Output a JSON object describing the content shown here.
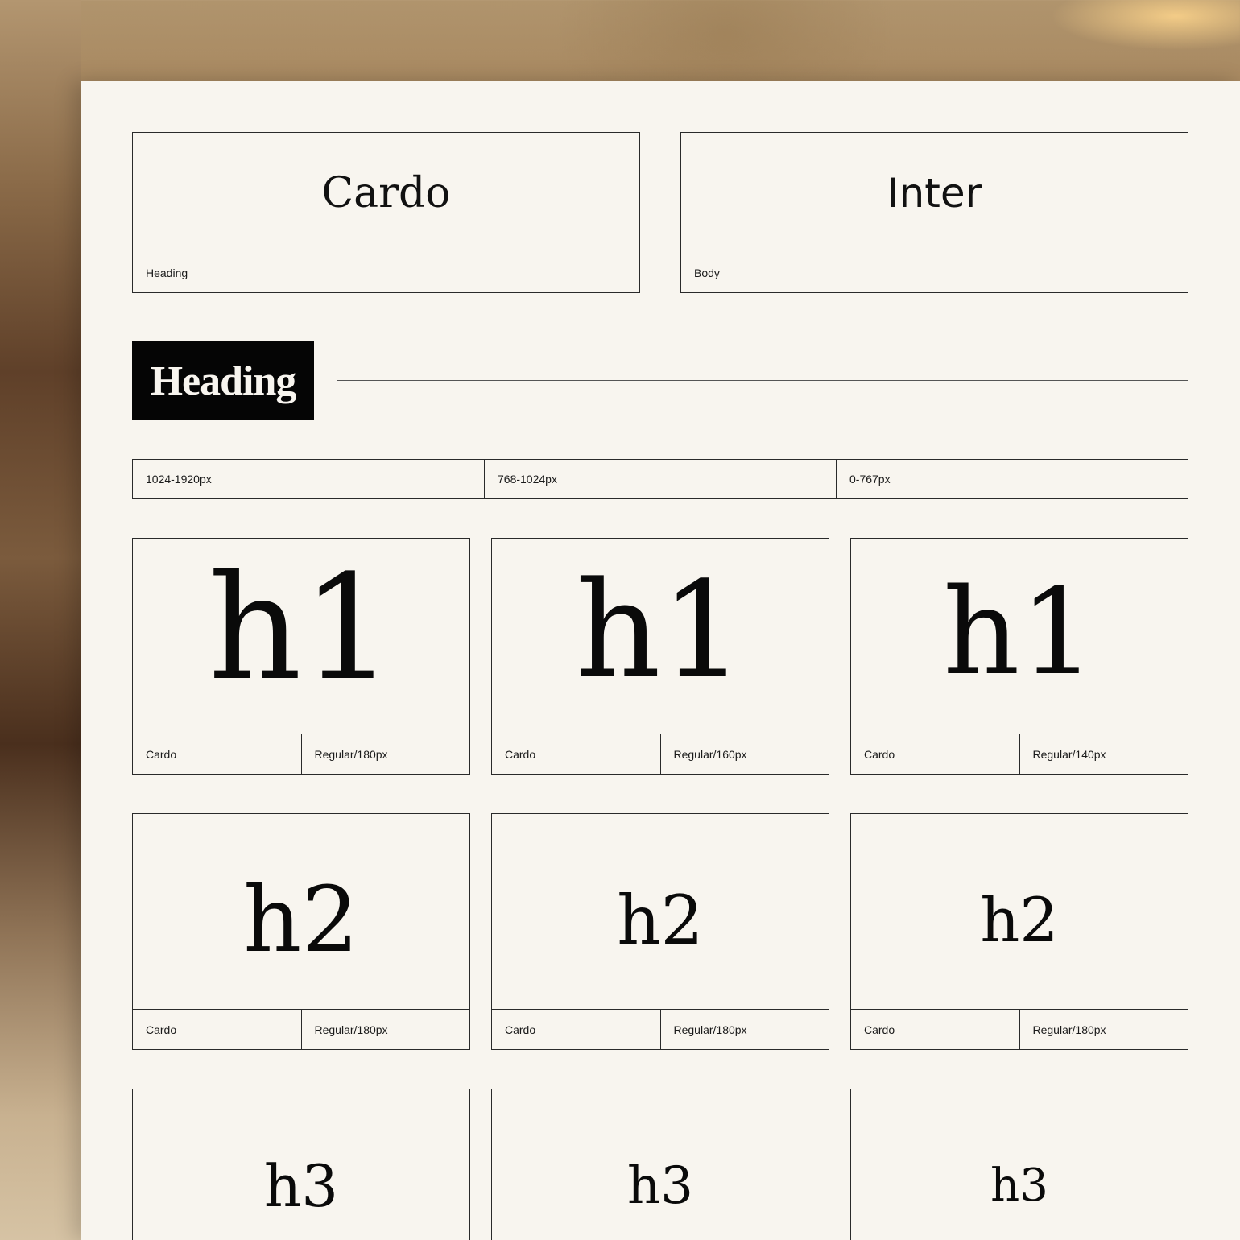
{
  "font_pairing": {
    "heading_font": {
      "name": "Cardo",
      "role": "Heading"
    },
    "body_font": {
      "name": "Inter",
      "role": "Body"
    }
  },
  "section": {
    "title": "Heading"
  },
  "breakpoints": [
    "1024-1920px",
    "768-1024px",
    "0-767px"
  ],
  "rows": [
    {
      "tag": "h1",
      "cards": [
        {
          "font": "Cardo",
          "spec": "Regular/180px"
        },
        {
          "font": "Cardo",
          "spec": "Regular/160px"
        },
        {
          "font": "Cardo",
          "spec": "Regular/140px"
        }
      ]
    },
    {
      "tag": "h2",
      "cards": [
        {
          "font": "Cardo",
          "spec": "Regular/180px"
        },
        {
          "font": "Cardo",
          "spec": "Regular/180px"
        },
        {
          "font": "Cardo",
          "spec": "Regular/180px"
        }
      ]
    },
    {
      "tag": "h3",
      "cards": [
        {
          "font": "",
          "spec": ""
        },
        {
          "font": "",
          "spec": ""
        },
        {
          "font": "",
          "spec": ""
        }
      ]
    }
  ]
}
